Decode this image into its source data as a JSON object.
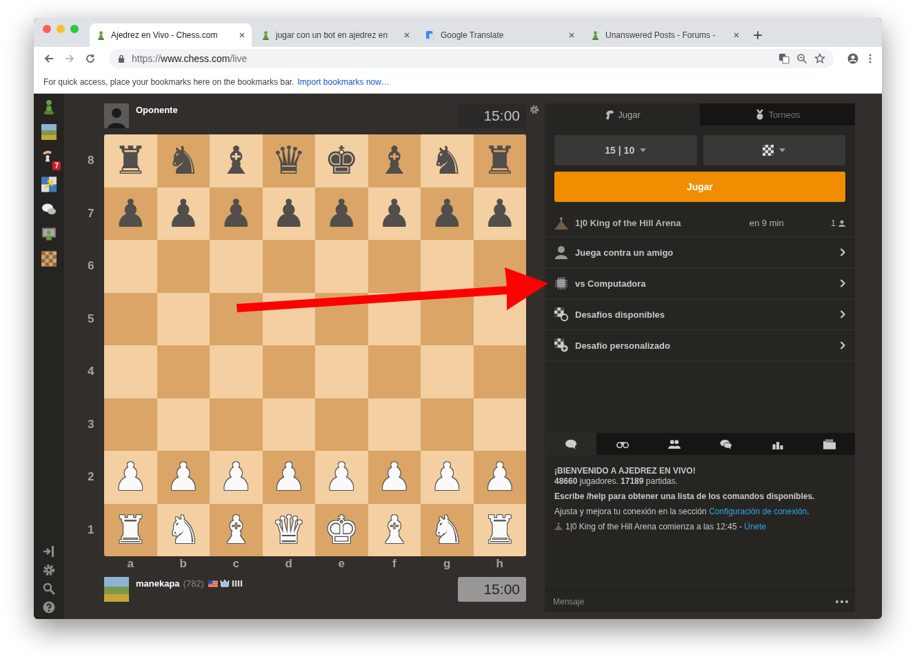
{
  "browser": {
    "tabs": [
      {
        "title": "Ajedrez en Vivo - Chess.com",
        "kind": "pawn",
        "selected": true
      },
      {
        "title": "jugar con un bot en ajedrez en",
        "kind": "pawn",
        "selected": false
      },
      {
        "title": "Google Translate",
        "kind": "translate",
        "selected": false
      },
      {
        "title": "Unanswered Posts - Forums -",
        "kind": "pawn",
        "selected": false
      }
    ],
    "url": {
      "scheme": "https://",
      "host": "www.chess.com",
      "path": "/live"
    },
    "bookmarks_bar": {
      "text": "For quick access, place your bookmarks here on the bookmarks bar.",
      "link": "Import bookmarks now…"
    }
  },
  "sidebar": {
    "notification_count": "7"
  },
  "opponent": {
    "name": "Oponente",
    "clock": "15:00"
  },
  "board": {
    "files": [
      "a",
      "b",
      "c",
      "d",
      "e",
      "f",
      "g",
      "h"
    ],
    "ranks": [
      {
        "label": "8",
        "squares": [
          {
            "glyph": "♜",
            "kind": "black"
          },
          {
            "glyph": "♞",
            "kind": "black"
          },
          {
            "glyph": "♝",
            "kind": "black"
          },
          {
            "glyph": "♛",
            "kind": "black"
          },
          {
            "glyph": "♚",
            "kind": "black"
          },
          {
            "glyph": "♝",
            "kind": "black"
          },
          {
            "glyph": "♞",
            "kind": "black"
          },
          {
            "glyph": "♜",
            "kind": "black"
          }
        ]
      },
      {
        "label": "7",
        "squares": [
          {
            "glyph": "♟",
            "kind": "black"
          },
          {
            "glyph": "♟",
            "kind": "black"
          },
          {
            "glyph": "♟",
            "kind": "black"
          },
          {
            "glyph": "♟",
            "kind": "black"
          },
          {
            "glyph": "♟",
            "kind": "black"
          },
          {
            "glyph": "♟",
            "kind": "black"
          },
          {
            "glyph": "♟",
            "kind": "black"
          },
          {
            "glyph": "♟",
            "kind": "black"
          }
        ]
      },
      {
        "label": "6"
      },
      {
        "label": "5"
      },
      {
        "label": "4"
      },
      {
        "label": "3"
      },
      {
        "label": "2",
        "squares": [
          {
            "glyph": "♟",
            "kind": "white"
          },
          {
            "glyph": "♟",
            "kind": "white"
          },
          {
            "glyph": "♟",
            "kind": "white"
          },
          {
            "glyph": "♟",
            "kind": "white"
          },
          {
            "glyph": "♟",
            "kind": "white"
          },
          {
            "glyph": "♟",
            "kind": "white"
          },
          {
            "glyph": "♟",
            "kind": "white"
          },
          {
            "glyph": "♟",
            "kind": "white"
          }
        ]
      },
      {
        "label": "1",
        "squares": [
          {
            "glyph": "♜",
            "kind": "white"
          },
          {
            "glyph": "♞",
            "kind": "white"
          },
          {
            "glyph": "♝",
            "kind": "white"
          },
          {
            "glyph": "♛",
            "kind": "white"
          },
          {
            "glyph": "♚",
            "kind": "white"
          },
          {
            "glyph": "♝",
            "kind": "white"
          },
          {
            "glyph": "♞",
            "kind": "white"
          },
          {
            "glyph": "♜",
            "kind": "white"
          }
        ]
      }
    ]
  },
  "player": {
    "name": "manekapa",
    "rating": "(782)",
    "clock": "15:00"
  },
  "panel": {
    "tabs": [
      {
        "label": "Jugar",
        "kind": "play",
        "selected": true
      },
      {
        "label": "Torneos",
        "kind": "tournaments",
        "selected": false
      }
    ],
    "time_control": "15 | 10",
    "play_button": "Jugar",
    "tournament": {
      "name": "1|0 King of the Hill Arena",
      "starts": "en 9 min",
      "players": "1"
    },
    "options": [
      {
        "label": "Juega contra un amigo",
        "kind": "friend"
      },
      {
        "label": "vs Computadora",
        "kind": "computer"
      },
      {
        "label": "Desafíos disponibles",
        "kind": "challenges"
      },
      {
        "label": "Desafío personalizado",
        "kind": "custom"
      }
    ],
    "chat_tabs": [
      {
        "kind": "chat",
        "selected": true
      },
      {
        "kind": "watch",
        "selected": false
      },
      {
        "kind": "friends",
        "selected": false
      },
      {
        "kind": "rooms",
        "selected": false
      },
      {
        "kind": "ranking",
        "selected": false
      },
      {
        "kind": "archive",
        "selected": false
      }
    ],
    "messages": [
      {
        "kind": "heading",
        "text": "¡BIENVENIDO A AJEDREZ EN VIVO!"
      },
      {
        "kind": "stats",
        "text": "**48660** jugadores. **17189** partidas."
      },
      {
        "kind": "bold",
        "text": "Escribe /help para obtener una lista de los comandos disponibles."
      },
      {
        "kind": "link",
        "text": "Ajusta y mejora tu conexión en la sección",
        "link": "Configuración de conexión",
        "after": "."
      },
      {
        "kind": "event",
        "text": "1|0 King of the Hill Arena comienza a las 12:45 -",
        "link": "Únete"
      }
    ],
    "message_placeholder": "Mensaje"
  }
}
